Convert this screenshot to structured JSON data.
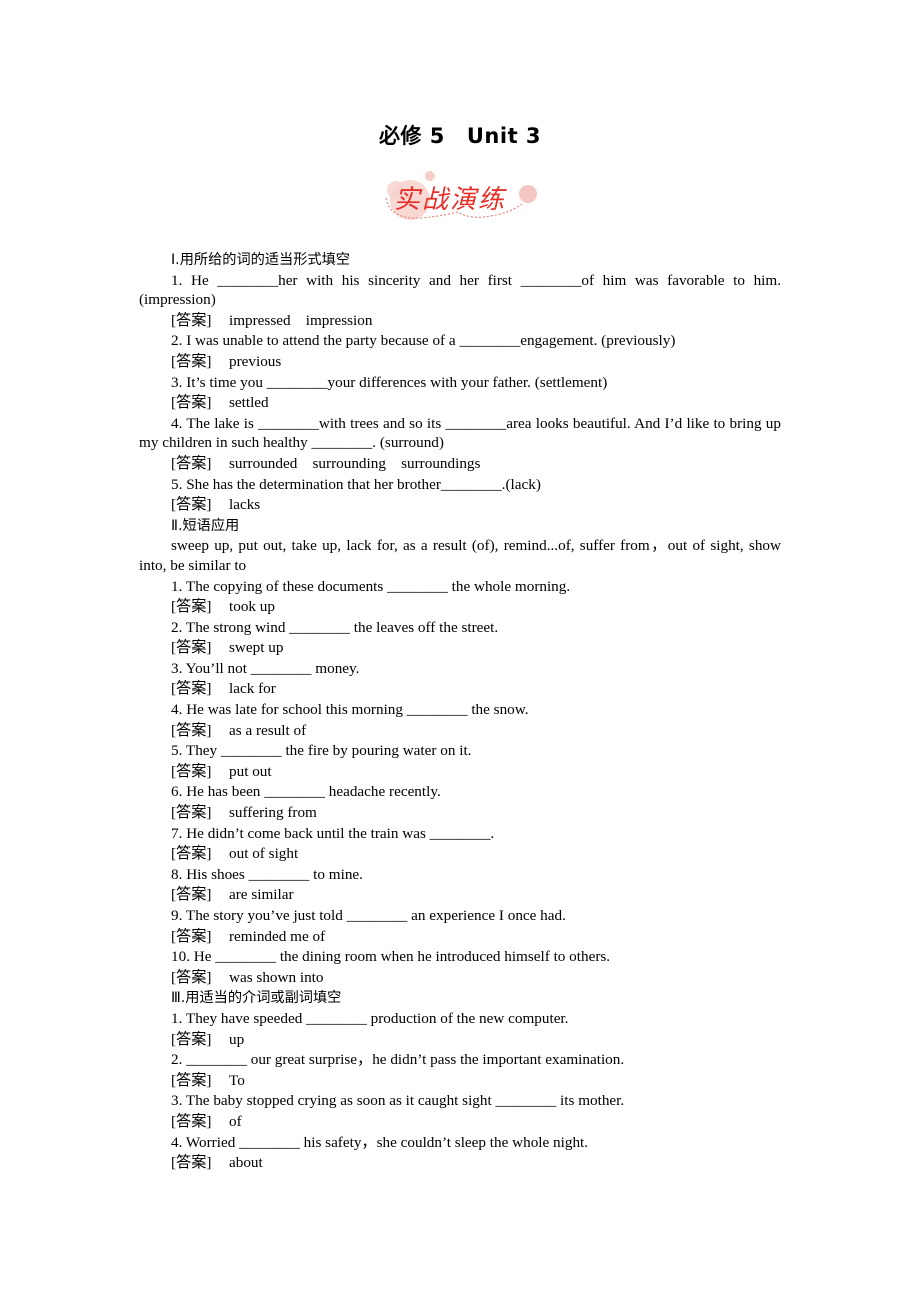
{
  "header": {
    "title_left": "必修 5",
    "title_right": "Unit 3",
    "banner_text": "实战演练",
    "banner_color": "#e8302a"
  },
  "answer_label": "[答案]",
  "sections": [
    {
      "heading": "Ⅰ.用所给的词的适当形式填空",
      "items": [
        {
          "q": "1. He ________her with his sincerity and her first ________of him was favorable to him. (impression)",
          "a": "impressed    impression"
        },
        {
          "q": "2. I was unable to attend the party because of a ________engagement. (previously)",
          "a": "previous"
        },
        {
          "q": "3. It’s time you ________your differences with your father. (settlement)",
          "a": "settled"
        },
        {
          "q": "4. The lake is ________with trees and so its ________area looks beautiful. And I’d like to bring up my children in such healthy ________. (surround)",
          "a": "surrounded    surrounding    surroundings"
        },
        {
          "q": "5. She has the determination that her brother________.(lack)",
          "a": "lacks"
        }
      ]
    },
    {
      "heading": "Ⅱ.短语应用",
      "phrase_bank": "sweep up, put out, take up, lack for, as a result (of), remind...of, suffer from，out of sight, show into, be similar to",
      "items": [
        {
          "q": "1. The copying of these documents ________ the whole morning.",
          "a": "took up"
        },
        {
          "q": "2. The strong wind ________ the leaves off the street.",
          "a": "swept up"
        },
        {
          "q": "3. You’ll not ________ money.",
          "a": "lack for"
        },
        {
          "q": "4. He was late for school this morning ________ the snow.",
          "a": "as a result of"
        },
        {
          "q": "5. They ________ the fire by pouring water on it.",
          "a": "put out"
        },
        {
          "q": "6. He has been ________ headache recently.",
          "a": "suffering from"
        },
        {
          "q": "7. He didn’t come back until the train was ________.",
          "a": "out of sight"
        },
        {
          "q": "8. His shoes ________ to mine.",
          "a": "are similar"
        },
        {
          "q": "9. The story you’ve just told ________ an experience I once had.",
          "a": "reminded me of"
        },
        {
          "q": "10. He ________ the dining room when he introduced himself to others.",
          "a": "was shown into"
        }
      ]
    },
    {
      "heading": "Ⅲ.用适当的介词或副词填空",
      "items": [
        {
          "q": "1. They have speeded ________ production of the new computer.",
          "a": "up"
        },
        {
          "q": "2. ________ our great surprise，he didn’t pass the important examination.",
          "a": "To"
        },
        {
          "q": "3. The baby stopped crying as soon as it caught sight ________ its mother.",
          "a": "of"
        },
        {
          "q": "4. Worried ________ his safety，she couldn’t sleep the whole night.",
          "a": "about"
        }
      ]
    }
  ]
}
